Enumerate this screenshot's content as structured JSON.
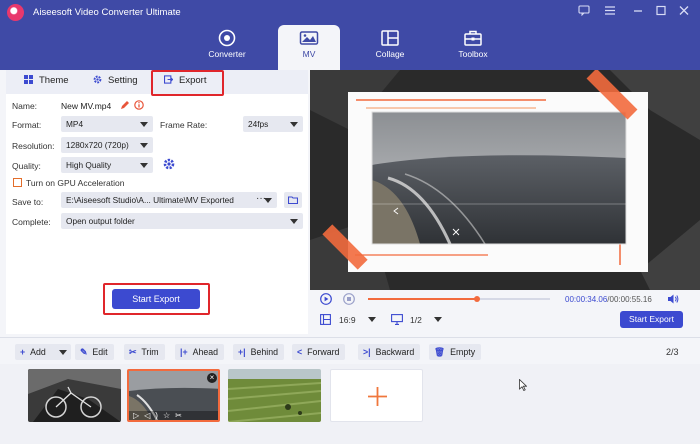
{
  "app": {
    "title": "Aiseesoft Video Converter Ultimate"
  },
  "nav": [
    {
      "label": "Converter",
      "icon": "converter-icon"
    },
    {
      "label": "MV",
      "icon": "mv-icon"
    },
    {
      "label": "Collage",
      "icon": "collage-icon"
    },
    {
      "label": "Toolbox",
      "icon": "toolbox-icon"
    }
  ],
  "tabs": [
    {
      "label": "Theme",
      "icon": "theme-icon"
    },
    {
      "label": "Setting",
      "icon": "gear-icon"
    },
    {
      "label": "Export",
      "icon": "export-icon"
    }
  ],
  "export": {
    "name_label": "Name:",
    "name_value": "New MV.mp4",
    "format_label": "Format:",
    "format_value": "MP4",
    "frame_rate_label": "Frame Rate:",
    "frame_rate_value": "24fps",
    "resolution_label": "Resolution:",
    "resolution_value": "1280x720 (720p)",
    "quality_label": "Quality:",
    "quality_value": "High Quality",
    "gpu_label": "Turn on GPU Acceleration",
    "save_label": "Save to:",
    "save_value": "E:\\Aiseesoft Studio\\A... Ultimate\\MV Exported",
    "save_more": "···",
    "complete_label": "Complete:",
    "complete_value": "Open output folder",
    "start_export": "Start Export"
  },
  "player": {
    "current_time": "00:00:34.06",
    "total_time": "00:00:55.16",
    "time_separator": "/",
    "progress": 0.6,
    "aspect": "16:9",
    "page": "1/2",
    "start_export": "Start Export"
  },
  "toolbar": {
    "add": "Add",
    "edit": "Edit",
    "trim": "Trim",
    "ahead": "Ahead",
    "behind": "Behind",
    "forward": "Forward",
    "backward": "Backward",
    "empty": "Empty",
    "clip_count": "2/3"
  },
  "colors": {
    "header": "#3f4aa6",
    "accent": "#3c4ad0",
    "highlight_box": "#e0262b",
    "progress": "#f26a3d",
    "add_plus": "#f0773c"
  }
}
